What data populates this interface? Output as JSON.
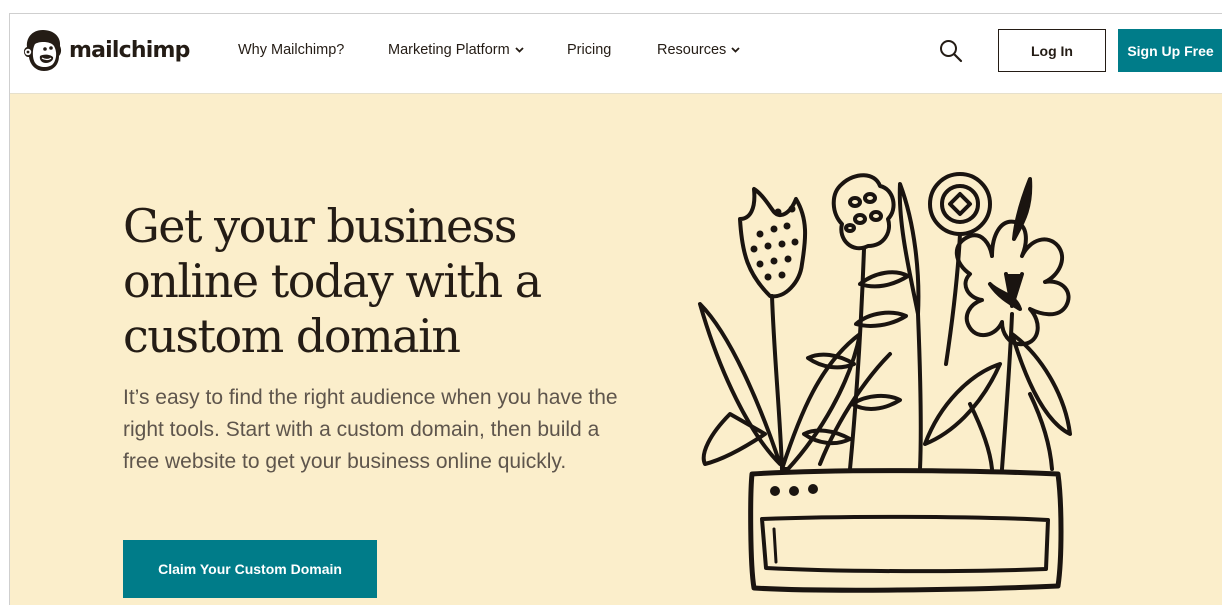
{
  "brand": {
    "name": "mailchimp"
  },
  "nav": {
    "items": [
      {
        "label": "Why Mailchimp?"
      },
      {
        "label": "Marketing Platform"
      },
      {
        "label": "Pricing"
      },
      {
        "label": "Resources"
      }
    ]
  },
  "header": {
    "login_label": "Log In",
    "signup_label": "Sign Up Free"
  },
  "hero": {
    "title": "Get your business online today with a custom domain",
    "description": "It’s easy to find the right audience when you have the right tools. Start with a custom domain, then build a free website to get your business online quickly.",
    "cta_label": "Claim Your Custom Domain"
  },
  "colors": {
    "accent": "#007c89",
    "hero_background": "#fbeecb",
    "text": "#241c15"
  },
  "icons": [
    "freddie-logo-icon",
    "search-icon",
    "chevron-down-icon",
    "flower-pot-illustration"
  ]
}
